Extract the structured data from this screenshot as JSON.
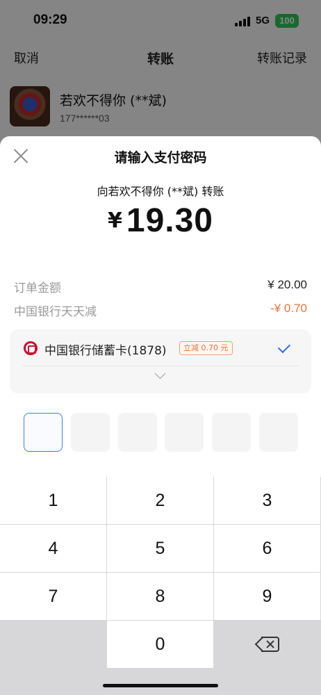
{
  "status_bar": {
    "time": "09:29",
    "network": "5G",
    "battery": "100"
  },
  "nav": {
    "left": "取消",
    "title": "转账",
    "right": "转账记录"
  },
  "payee": {
    "name": "若欢不得你 (**斌)",
    "phone": "177******03"
  },
  "sheet": {
    "title": "请输入支付密码",
    "transfer_to": "向若欢不得你 (**斌) 转账",
    "currency": "¥",
    "amount": "19.30",
    "rows": [
      {
        "label": "订单金额",
        "value": "¥ 20.00"
      },
      {
        "label": "中国银行天天减",
        "value": "-¥ 0.70"
      }
    ],
    "card": {
      "name": "中国银行储蓄卡(1878)",
      "badge": "立减 0.70 元"
    },
    "pin_length": 6,
    "pin_filled": 0
  },
  "keypad": {
    "keys": [
      "1",
      "2",
      "3",
      "4",
      "5",
      "6",
      "7",
      "8",
      "9",
      "0"
    ]
  },
  "colors": {
    "discount": "#e8733a",
    "accent": "#2e6fe6",
    "bank_red": "#c8102e",
    "battery": "#34c759"
  }
}
